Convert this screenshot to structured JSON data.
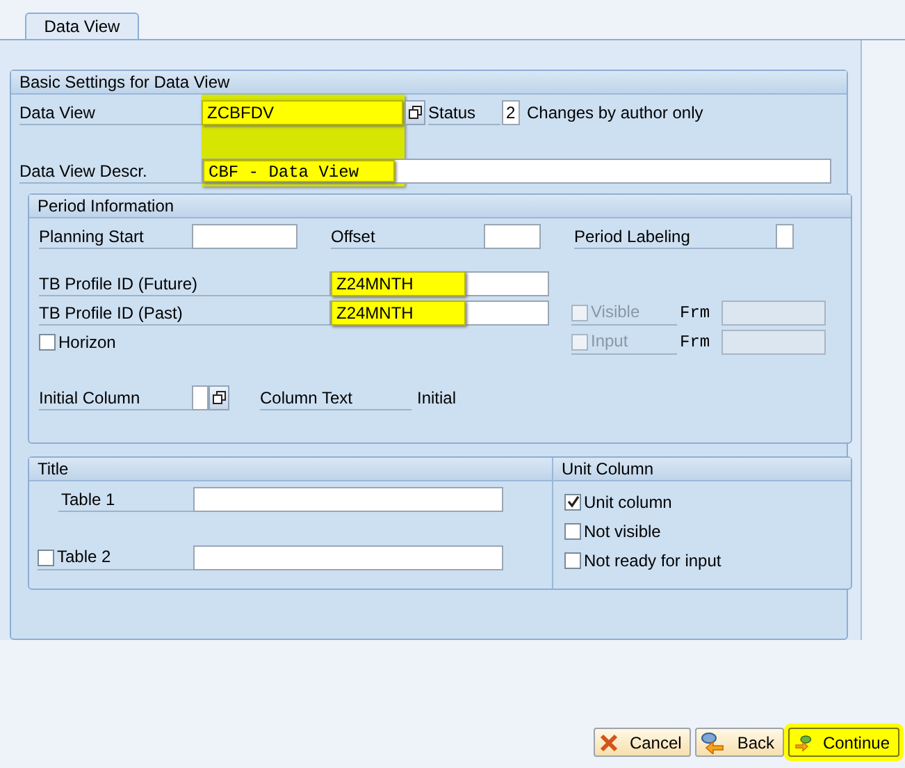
{
  "tab": {
    "label": "Data View",
    "selected": true
  },
  "basic": {
    "title": "Basic Settings for Data View",
    "data_view": {
      "label": "Data View",
      "value": "ZCBFDV",
      "highlighted": true
    },
    "status": {
      "label": "Status",
      "value": "2",
      "text": "Changes by author only"
    },
    "description": {
      "label": "Data View Descr.",
      "value": "CBF - Data View",
      "highlighted": true
    }
  },
  "period": {
    "title": "Period Information",
    "planning_start": {
      "label": "Planning Start"
    },
    "offset": {
      "label": "Offset"
    },
    "period_labeling": {
      "label": "Period Labeling"
    },
    "tb_future": {
      "label": "TB Profile ID (Future)",
      "value": "Z24MNTH",
      "highlighted": true
    },
    "tb_past": {
      "label": "TB Profile ID (Past)",
      "value": "Z24MNTH",
      "highlighted": true
    },
    "horizon": {
      "label": "Horizon",
      "checked": false
    },
    "visible": {
      "label": "Visible",
      "checked": false,
      "disabled": true,
      "from_label": "Frm"
    },
    "input": {
      "label": "Input",
      "checked": false,
      "disabled": true,
      "from_label": "Frm"
    },
    "initial_column": {
      "label": "Initial Column"
    },
    "column_text": {
      "label": "Column Text",
      "value": "Initial"
    }
  },
  "title_group": {
    "title": "Title",
    "rows": [
      {
        "label": "Table 1",
        "kind": "plain"
      },
      {
        "label": "Table 2",
        "kind": "checkbox",
        "checked": false
      }
    ]
  },
  "unit_column": {
    "title": "Unit Column",
    "options": [
      {
        "label": "Unit column",
        "checked": true
      },
      {
        "label": "Not visible",
        "checked": false
      },
      {
        "label": "Not ready for input",
        "checked": false
      }
    ]
  },
  "buttons": [
    {
      "label": "Cancel",
      "kind": "cancel",
      "highlighted": false
    },
    {
      "label": "Back",
      "kind": "back",
      "highlighted": false
    },
    {
      "label": "Continue",
      "kind": "continue",
      "highlighted": true
    }
  ]
}
